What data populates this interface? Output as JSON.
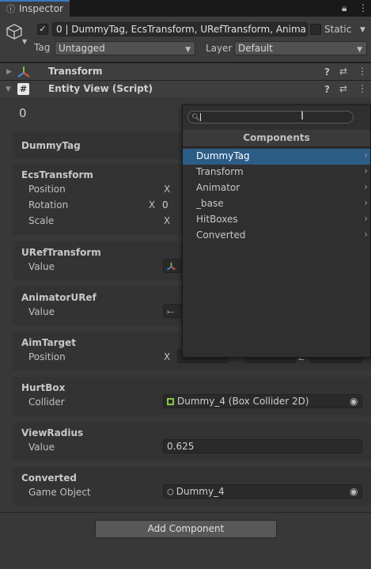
{
  "tab": {
    "label": "Inspector"
  },
  "header": {
    "object_name": "0 | DummyTag, EcsTransform, URefTransform, Anima",
    "static_label": "Static",
    "tag_label": "Tag",
    "tag_value": "Untagged",
    "layer_label": "Layer",
    "layer_value": "Default"
  },
  "components": {
    "transform": "Transform",
    "entity_view": "Entity View (Script)"
  },
  "entity": {
    "id": "0",
    "sections": {
      "dummy_tag": "DummyTag",
      "ecs_transform": "EcsTransform",
      "position": "Position",
      "rotation": "Rotation",
      "scale": "Scale",
      "uref_transform": "URefTransform",
      "uref_value_label": "Value",
      "animator_uref": "AnimatorURef",
      "animator_value_label": "Value",
      "aim_target": "AimTarget",
      "aim_position": "Position",
      "hurt_box": "HurtBox",
      "collider_label": "Collider",
      "collider_value": "Dummy_4 (Box Collider 2D)",
      "view_radius": "ViewRadius",
      "view_value_label": "Value",
      "view_value": "0.625",
      "converted": "Converted",
      "game_object_label": "Game Object",
      "game_object_value": "Dummy_4"
    },
    "axis_x": "X",
    "axis_z": "Z",
    "partial_zero": "0"
  },
  "popup": {
    "search_value": "",
    "title": "Components",
    "items": [
      "DummyTag",
      "Transform",
      "Animator",
      "_base",
      "HitBoxes",
      "Converted"
    ],
    "selected_index": 0
  },
  "add_component": "Add Component",
  "colors": {
    "accent": "#2c5d87",
    "tab_highlight": "#3a79bb"
  }
}
